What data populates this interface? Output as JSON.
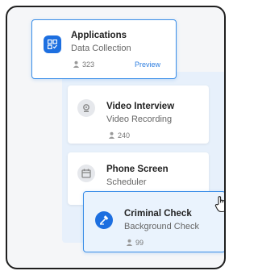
{
  "cards": {
    "applications": {
      "title": "Applications",
      "subtitle": "Data Collection",
      "count": "323",
      "action": "Preview"
    },
    "video_interview": {
      "title": "Video Interview",
      "subtitle": "Video Recording",
      "count": "240"
    },
    "phone_screen": {
      "title": "Phone Screen",
      "subtitle": "Scheduler"
    },
    "criminal_check": {
      "title": "Criminal Check",
      "subtitle": "Background Check",
      "count": "99"
    }
  },
  "colors": {
    "accent": "#1d6fe0",
    "highlight_border": "#3b8ee8",
    "panel": "#e7f0fb"
  }
}
